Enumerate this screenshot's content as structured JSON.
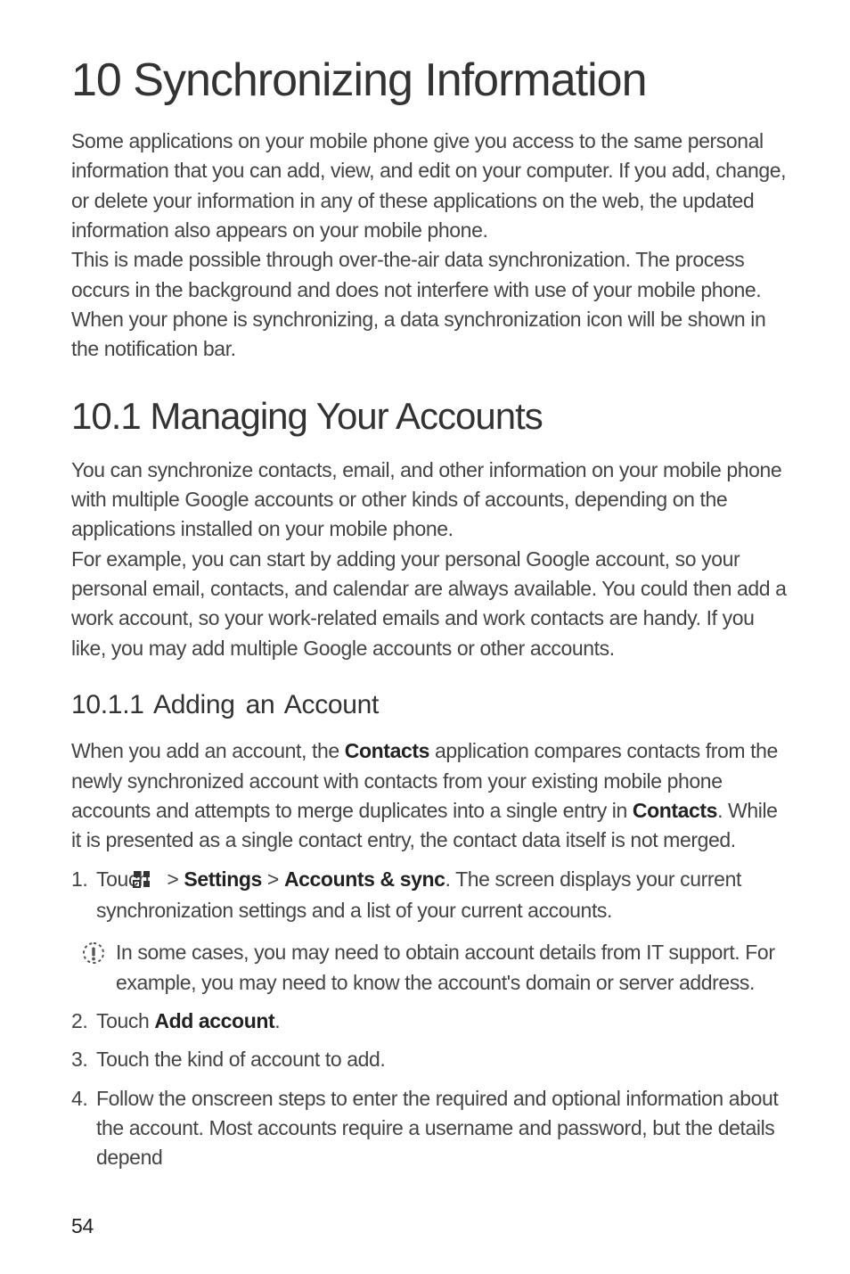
{
  "h1": "10  Synchronizing Information",
  "intro1": "Some applications on your mobile phone give you access to the same personal information that you can add, view, and edit on your computer. If you add, change, or delete your information in any of these applications on the web, the updated information also appears on your mobile phone.",
  "intro2": "This is made possible through over-the-air data synchronization. The process occurs in the background and does not interfere with use of your mobile phone. When your phone is synchronizing, a data synchronization icon will be shown in the notification bar.",
  "h2": "10.1  Managing Your Accounts",
  "sec1p1": "You can synchronize contacts, email, and other information on your mobile phone with multiple Google accounts or other kinds of accounts, depending on the applications installed on your mobile phone.",
  "sec1p2": "For example, you can start by adding your personal Google account, so your personal email, contacts, and calendar are always available. You could then add a work account, so your work-related emails and work contacts are handy. If you like, you may add multiple Google accounts or other accounts.",
  "h3": "10.1.1  Adding an Account",
  "sub1p1a": "When you add an account, the ",
  "sub1p1b": "Contacts",
  "sub1p1c": " application compares contacts from the newly synchronized account with contacts from your existing mobile phone accounts and attempts to merge duplicates into a single entry in ",
  "sub1p1d": "Contacts",
  "sub1p1e": ". While it is presented as a single contact entry, the contact data itself is not merged.",
  "step1a": "Touch ",
  "step1b": " > ",
  "step1c": "Settings",
  "step1d": " > ",
  "step1e": "Accounts & sync",
  "step1f": ". The screen displays your current synchronization settings and a list of your current accounts.",
  "note1": "In some cases, you may need to obtain account details from IT support. For example, you may need to know the account's domain or server address.",
  "step2a": "Touch ",
  "step2b": "Add account",
  "step2c": ".",
  "step3": "Touch the kind of account to add.",
  "step4": "Follow the onscreen steps to enter the required and optional information about the account. Most accounts require a username and password, but the details depend",
  "n1": "1.",
  "n2": "2.",
  "n3": "3.",
  "n4": "4.",
  "pagenum": "54"
}
